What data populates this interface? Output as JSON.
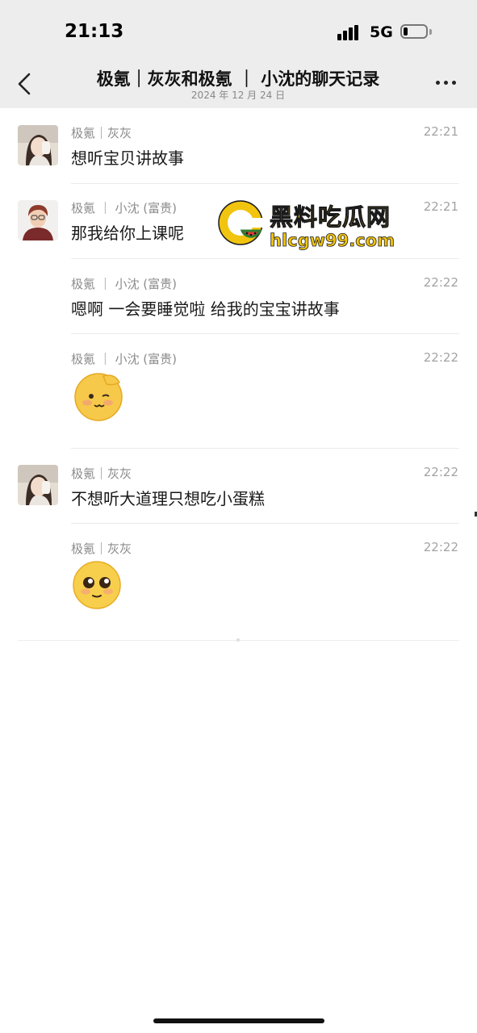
{
  "status_bar": {
    "time": "21:13",
    "network": "5G",
    "battery_percent": 20
  },
  "header": {
    "back_icon": "chevron-left-icon",
    "title": "极氪｜灰灰和极氪 ｜ 小沈的聊天记录",
    "subtitle": "2024 年 12 月 24 日",
    "more_icon": "more-dots-icon"
  },
  "messages": [
    {
      "sender": "极氪｜灰灰",
      "time": "22:21",
      "text": "想听宝贝讲故事",
      "avatar": "avatar-huihui"
    },
    {
      "sender": "极氪 ｜ 小沈 (富贵)",
      "time": "22:21",
      "text": "那我给你上课呢",
      "avatar": "avatar-xiaoshen"
    },
    {
      "sender": "极氪 ｜ 小沈 (富贵)",
      "time": "22:22",
      "text": "嗯啊 一会要睡觉啦 给我的宝宝讲故事"
    },
    {
      "sender": "极氪 ｜ 小沈 (富贵)",
      "time": "22:22",
      "sticker": "salute-emoji-icon"
    },
    {
      "sender": "极氪｜灰灰",
      "time": "22:22",
      "text": "不想听大道理只想吃小蛋糕",
      "avatar": "avatar-huihui"
    },
    {
      "sender": "极氪｜灰灰",
      "time": "22:22",
      "sticker": "pleading-emoji-icon"
    }
  ],
  "watermark": {
    "title": "黑料吃瓜网",
    "url": "hlcgw99.com"
  },
  "colors": {
    "header_bg": "#ededed",
    "watermark_yellow": "#f1c40f"
  }
}
